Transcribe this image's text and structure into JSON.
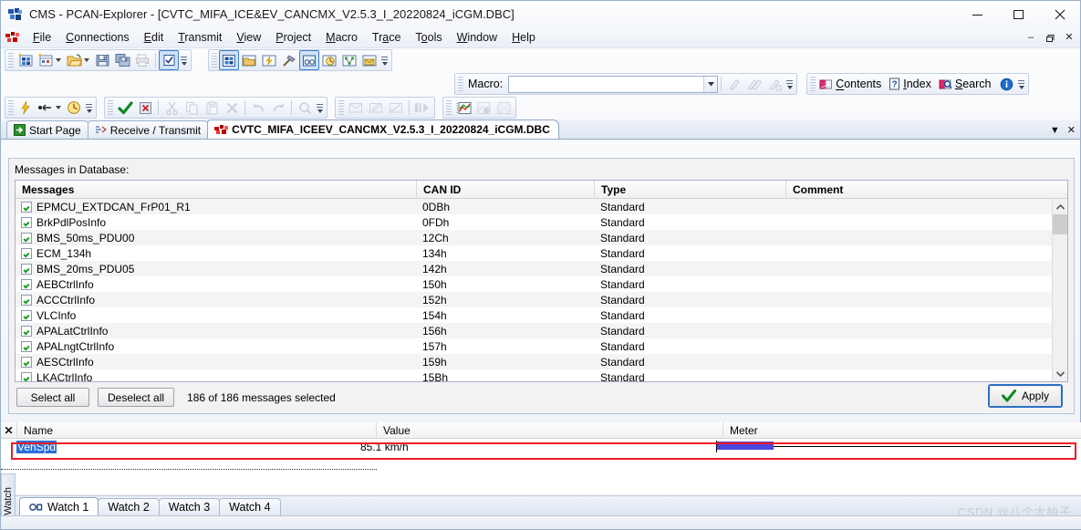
{
  "window": {
    "title": "CMS - PCAN-Explorer - [CVTC_MIFA_ICE&EV_CANCMX_V2.5.3_I_20220824_iCGM.DBC]",
    "minimize_label": "—",
    "maximize_label": "☐",
    "close_label": "✕"
  },
  "menu": {
    "items": [
      {
        "label": "File",
        "accel": "F"
      },
      {
        "label": "Connections",
        "accel": "C"
      },
      {
        "label": "Edit",
        "accel": "E"
      },
      {
        "label": "Transmit",
        "accel": "T"
      },
      {
        "label": "View",
        "accel": "V"
      },
      {
        "label": "Project",
        "accel": "P"
      },
      {
        "label": "Macro",
        "accel": "M"
      },
      {
        "label": "Trace",
        "accel": "a"
      },
      {
        "label": "Tools",
        "accel": "o"
      },
      {
        "label": "Window",
        "accel": "W"
      },
      {
        "label": "Help",
        "accel": "H"
      }
    ],
    "mdi": {
      "minimize": "–",
      "restore": "❐",
      "close": "✕"
    }
  },
  "macro": {
    "label": "Macro:",
    "value": "",
    "placeholder": ""
  },
  "help_toolbar": {
    "contents": "Contents",
    "index": "Index",
    "search": "Search"
  },
  "tabs": {
    "items": [
      {
        "label": "Start Page",
        "icon": "start-page-icon",
        "active": false
      },
      {
        "label": "Receive / Transmit",
        "icon": "receive-transmit-icon",
        "active": false
      },
      {
        "label": "CVTC_MIFA_ICEEV_CANCMX_V2.5.3_I_20220824_iCGM.DBC",
        "icon": "dbc-icon",
        "active": true
      }
    ],
    "list_button": "▼",
    "close_button": "✕"
  },
  "dbc": {
    "section_label": "Messages in Database:",
    "columns": [
      "Messages",
      "CAN ID",
      "Type",
      "Comment"
    ],
    "rows": [
      {
        "checked": true,
        "name": "EPMCU_EXTDCAN_FrP01_R1",
        "can_id": "0DBh",
        "type": "Standard",
        "comment": ""
      },
      {
        "checked": true,
        "name": "BrkPdlPosInfo",
        "can_id": "0FDh",
        "type": "Standard",
        "comment": ""
      },
      {
        "checked": true,
        "name": "BMS_50ms_PDU00",
        "can_id": "12Ch",
        "type": "Standard",
        "comment": ""
      },
      {
        "checked": true,
        "name": "ECM_134h",
        "can_id": "134h",
        "type": "Standard",
        "comment": ""
      },
      {
        "checked": true,
        "name": "BMS_20ms_PDU05",
        "can_id": "142h",
        "type": "Standard",
        "comment": ""
      },
      {
        "checked": true,
        "name": "AEBCtrlInfo",
        "can_id": "150h",
        "type": "Standard",
        "comment": ""
      },
      {
        "checked": true,
        "name": "ACCCtrlInfo",
        "can_id": "152h",
        "type": "Standard",
        "comment": ""
      },
      {
        "checked": true,
        "name": "VLCInfo",
        "can_id": "154h",
        "type": "Standard",
        "comment": ""
      },
      {
        "checked": true,
        "name": "APALatCtrlInfo",
        "can_id": "156h",
        "type": "Standard",
        "comment": ""
      },
      {
        "checked": true,
        "name": "APALngtCtrlInfo",
        "can_id": "157h",
        "type": "Standard",
        "comment": ""
      },
      {
        "checked": true,
        "name": "AESCtrlInfo",
        "can_id": "159h",
        "type": "Standard",
        "comment": ""
      },
      {
        "checked": true,
        "name": "LKACtrlInfo",
        "can_id": "15Bh",
        "type": "Standard",
        "comment": ""
      }
    ],
    "select_all": "Select all",
    "deselect_all": "Deselect all",
    "selection_status": "186 of 186 messages selected",
    "apply": "Apply"
  },
  "watch": {
    "close_label": "✕",
    "columns": [
      "Name",
      "Value",
      "Meter"
    ],
    "rows": [
      {
        "name": "VehSpd",
        "value": "85.1 km/h",
        "meter_percent": 17,
        "selected": true
      }
    ],
    "side_label": "Watch",
    "tabs": [
      {
        "label": "Watch 1",
        "active": true
      },
      {
        "label": "Watch 2",
        "active": false
      },
      {
        "label": "Watch 3",
        "active": false
      },
      {
        "label": "Watch 4",
        "active": false
      }
    ]
  },
  "watermark": "CSDN @八个大柚子",
  "colors": {
    "accent_blue": "#2d6fc4",
    "selection_blue": "#2a6fd6",
    "meter_fill": "#4a48e0",
    "annotation_red": "#ed1c24",
    "check_green": "#1a9a21"
  }
}
